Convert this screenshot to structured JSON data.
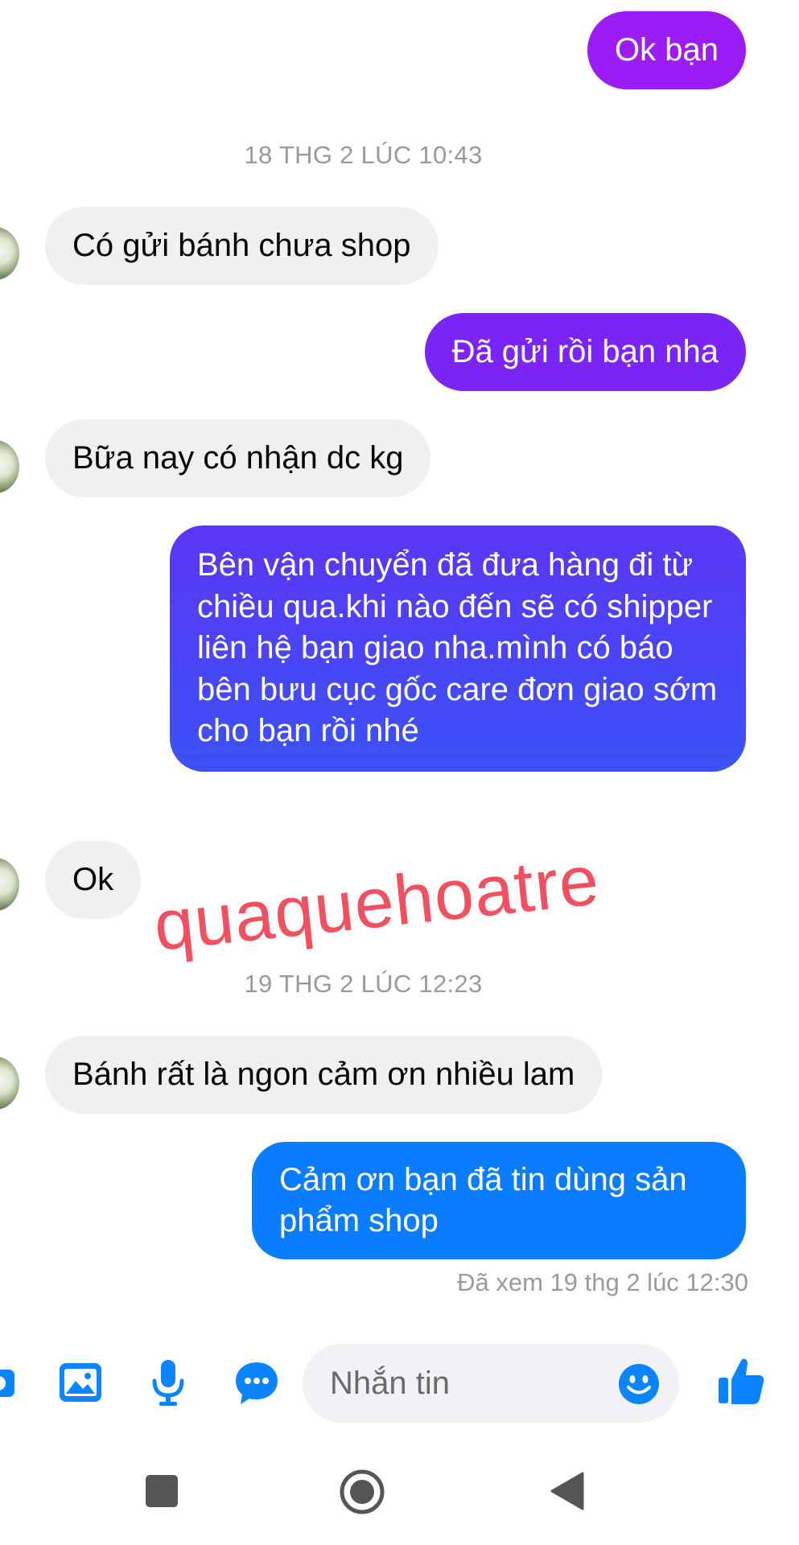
{
  "conversation": {
    "messages": [
      {
        "direction": "out",
        "text": "Ok bạn"
      },
      {
        "direction": "in",
        "text": "Có gửi bánh chưa shop"
      },
      {
        "direction": "out",
        "text": "Đã gửi rồi bạn nha"
      },
      {
        "direction": "in",
        "text": "Bữa nay có nhận dc kg"
      },
      {
        "direction": "out",
        "text": "Bên vận chuyển đã đưa hàng đi từ chiều qua.khi nào đến sẽ có shipper liên hệ bạn giao nha.mình có báo bên bưu cục gốc care đơn giao sớm cho bạn rồi nhé"
      },
      {
        "direction": "in",
        "text": "Ok"
      },
      {
        "direction": "in",
        "text": "Bánh rất là ngon cảm ơn nhiều lam"
      },
      {
        "direction": "out",
        "text": "Cảm ơn bạn đã tin dùng sản phẩm shop"
      }
    ],
    "timestamps": [
      "18 THG 2 LÚC 10:43",
      "19 THG 2 LÚC 12:23"
    ],
    "seen_status": "Đã xem 19 thg 2 lúc 12:30",
    "watermark": "quaquehoatre"
  },
  "composer": {
    "placeholder": "Nhắn tin",
    "icons": [
      "camera-icon",
      "image-icon",
      "microphone-icon",
      "chat-bubble-icon",
      "emoji-icon",
      "like-icon"
    ]
  },
  "navbar": {
    "icons": [
      "square-icon",
      "home-circle-icon",
      "back-triangle-icon"
    ]
  },
  "colors": {
    "accent": "#0084ff",
    "purple": "#9b1cf5",
    "violet": "#6a2cf5",
    "indigo": "#4a45f5",
    "incoming_bg": "#f0f0f0"
  }
}
